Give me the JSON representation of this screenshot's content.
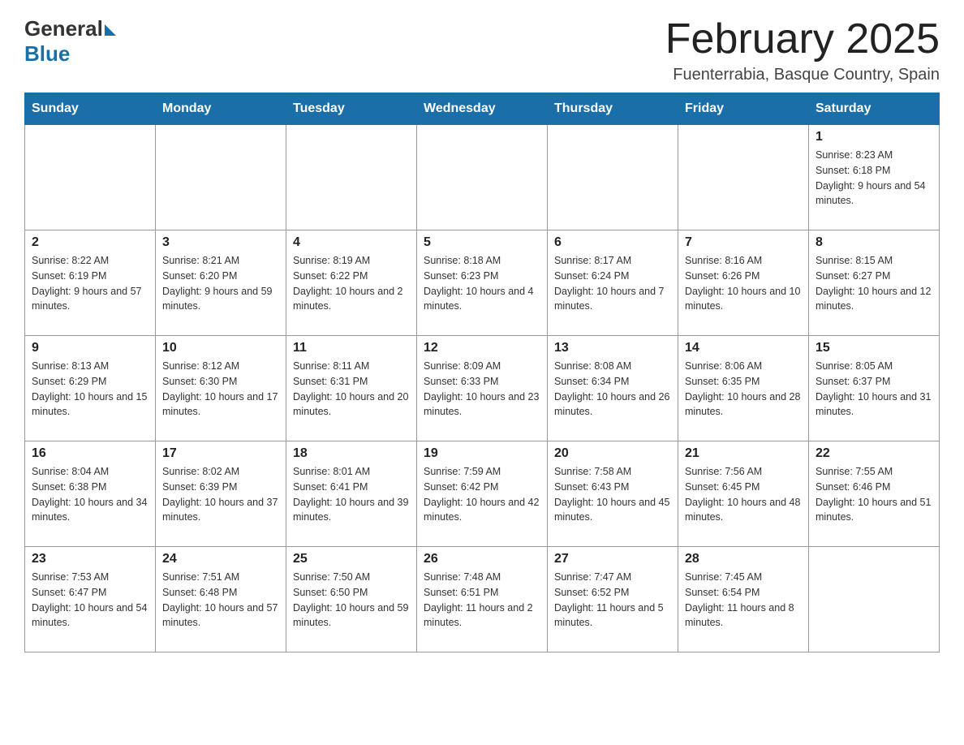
{
  "header": {
    "logo": {
      "general": "General",
      "blue": "Blue"
    },
    "title": "February 2025",
    "location": "Fuenterrabia, Basque Country, Spain"
  },
  "days_of_week": [
    "Sunday",
    "Monday",
    "Tuesday",
    "Wednesday",
    "Thursday",
    "Friday",
    "Saturday"
  ],
  "weeks": [
    [
      {
        "day": "",
        "sunrise": "",
        "sunset": "",
        "daylight": "",
        "empty": true
      },
      {
        "day": "",
        "sunrise": "",
        "sunset": "",
        "daylight": "",
        "empty": true
      },
      {
        "day": "",
        "sunrise": "",
        "sunset": "",
        "daylight": "",
        "empty": true
      },
      {
        "day": "",
        "sunrise": "",
        "sunset": "",
        "daylight": "",
        "empty": true
      },
      {
        "day": "",
        "sunrise": "",
        "sunset": "",
        "daylight": "",
        "empty": true
      },
      {
        "day": "",
        "sunrise": "",
        "sunset": "",
        "daylight": "",
        "empty": true
      },
      {
        "day": "1",
        "sunrise": "Sunrise: 8:23 AM",
        "sunset": "Sunset: 6:18 PM",
        "daylight": "Daylight: 9 hours and 54 minutes.",
        "empty": false
      }
    ],
    [
      {
        "day": "2",
        "sunrise": "Sunrise: 8:22 AM",
        "sunset": "Sunset: 6:19 PM",
        "daylight": "Daylight: 9 hours and 57 minutes.",
        "empty": false
      },
      {
        "day": "3",
        "sunrise": "Sunrise: 8:21 AM",
        "sunset": "Sunset: 6:20 PM",
        "daylight": "Daylight: 9 hours and 59 minutes.",
        "empty": false
      },
      {
        "day": "4",
        "sunrise": "Sunrise: 8:19 AM",
        "sunset": "Sunset: 6:22 PM",
        "daylight": "Daylight: 10 hours and 2 minutes.",
        "empty": false
      },
      {
        "day": "5",
        "sunrise": "Sunrise: 8:18 AM",
        "sunset": "Sunset: 6:23 PM",
        "daylight": "Daylight: 10 hours and 4 minutes.",
        "empty": false
      },
      {
        "day": "6",
        "sunrise": "Sunrise: 8:17 AM",
        "sunset": "Sunset: 6:24 PM",
        "daylight": "Daylight: 10 hours and 7 minutes.",
        "empty": false
      },
      {
        "day": "7",
        "sunrise": "Sunrise: 8:16 AM",
        "sunset": "Sunset: 6:26 PM",
        "daylight": "Daylight: 10 hours and 10 minutes.",
        "empty": false
      },
      {
        "day": "8",
        "sunrise": "Sunrise: 8:15 AM",
        "sunset": "Sunset: 6:27 PM",
        "daylight": "Daylight: 10 hours and 12 minutes.",
        "empty": false
      }
    ],
    [
      {
        "day": "9",
        "sunrise": "Sunrise: 8:13 AM",
        "sunset": "Sunset: 6:29 PM",
        "daylight": "Daylight: 10 hours and 15 minutes.",
        "empty": false
      },
      {
        "day": "10",
        "sunrise": "Sunrise: 8:12 AM",
        "sunset": "Sunset: 6:30 PM",
        "daylight": "Daylight: 10 hours and 17 minutes.",
        "empty": false
      },
      {
        "day": "11",
        "sunrise": "Sunrise: 8:11 AM",
        "sunset": "Sunset: 6:31 PM",
        "daylight": "Daylight: 10 hours and 20 minutes.",
        "empty": false
      },
      {
        "day": "12",
        "sunrise": "Sunrise: 8:09 AM",
        "sunset": "Sunset: 6:33 PM",
        "daylight": "Daylight: 10 hours and 23 minutes.",
        "empty": false
      },
      {
        "day": "13",
        "sunrise": "Sunrise: 8:08 AM",
        "sunset": "Sunset: 6:34 PM",
        "daylight": "Daylight: 10 hours and 26 minutes.",
        "empty": false
      },
      {
        "day": "14",
        "sunrise": "Sunrise: 8:06 AM",
        "sunset": "Sunset: 6:35 PM",
        "daylight": "Daylight: 10 hours and 28 minutes.",
        "empty": false
      },
      {
        "day": "15",
        "sunrise": "Sunrise: 8:05 AM",
        "sunset": "Sunset: 6:37 PM",
        "daylight": "Daylight: 10 hours and 31 minutes.",
        "empty": false
      }
    ],
    [
      {
        "day": "16",
        "sunrise": "Sunrise: 8:04 AM",
        "sunset": "Sunset: 6:38 PM",
        "daylight": "Daylight: 10 hours and 34 minutes.",
        "empty": false
      },
      {
        "day": "17",
        "sunrise": "Sunrise: 8:02 AM",
        "sunset": "Sunset: 6:39 PM",
        "daylight": "Daylight: 10 hours and 37 minutes.",
        "empty": false
      },
      {
        "day": "18",
        "sunrise": "Sunrise: 8:01 AM",
        "sunset": "Sunset: 6:41 PM",
        "daylight": "Daylight: 10 hours and 39 minutes.",
        "empty": false
      },
      {
        "day": "19",
        "sunrise": "Sunrise: 7:59 AM",
        "sunset": "Sunset: 6:42 PM",
        "daylight": "Daylight: 10 hours and 42 minutes.",
        "empty": false
      },
      {
        "day": "20",
        "sunrise": "Sunrise: 7:58 AM",
        "sunset": "Sunset: 6:43 PM",
        "daylight": "Daylight: 10 hours and 45 minutes.",
        "empty": false
      },
      {
        "day": "21",
        "sunrise": "Sunrise: 7:56 AM",
        "sunset": "Sunset: 6:45 PM",
        "daylight": "Daylight: 10 hours and 48 minutes.",
        "empty": false
      },
      {
        "day": "22",
        "sunrise": "Sunrise: 7:55 AM",
        "sunset": "Sunset: 6:46 PM",
        "daylight": "Daylight: 10 hours and 51 minutes.",
        "empty": false
      }
    ],
    [
      {
        "day": "23",
        "sunrise": "Sunrise: 7:53 AM",
        "sunset": "Sunset: 6:47 PM",
        "daylight": "Daylight: 10 hours and 54 minutes.",
        "empty": false
      },
      {
        "day": "24",
        "sunrise": "Sunrise: 7:51 AM",
        "sunset": "Sunset: 6:48 PM",
        "daylight": "Daylight: 10 hours and 57 minutes.",
        "empty": false
      },
      {
        "day": "25",
        "sunrise": "Sunrise: 7:50 AM",
        "sunset": "Sunset: 6:50 PM",
        "daylight": "Daylight: 10 hours and 59 minutes.",
        "empty": false
      },
      {
        "day": "26",
        "sunrise": "Sunrise: 7:48 AM",
        "sunset": "Sunset: 6:51 PM",
        "daylight": "Daylight: 11 hours and 2 minutes.",
        "empty": false
      },
      {
        "day": "27",
        "sunrise": "Sunrise: 7:47 AM",
        "sunset": "Sunset: 6:52 PM",
        "daylight": "Daylight: 11 hours and 5 minutes.",
        "empty": false
      },
      {
        "day": "28",
        "sunrise": "Sunrise: 7:45 AM",
        "sunset": "Sunset: 6:54 PM",
        "daylight": "Daylight: 11 hours and 8 minutes.",
        "empty": false
      },
      {
        "day": "",
        "sunrise": "",
        "sunset": "",
        "daylight": "",
        "empty": true
      }
    ]
  ]
}
